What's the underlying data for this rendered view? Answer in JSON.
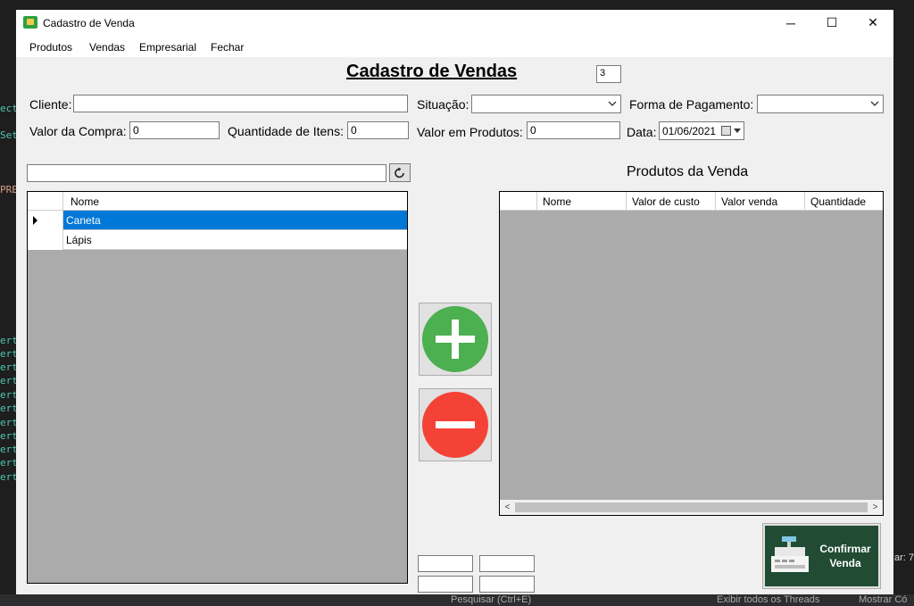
{
  "window": {
    "title": "Cadastro de Venda",
    "minimize": "─",
    "maximize": "☐",
    "close": "✕"
  },
  "menu": [
    "Produtos",
    "Vendas",
    "Empresarial",
    "Fechar"
  ],
  "form": {
    "heading": "Cadastro de Vendas",
    "sale_id": "3",
    "cliente_label": "Cliente:",
    "cliente_value": "",
    "situacao_label": "Situação:",
    "situacao_value": "",
    "pagamento_label": "Forma de Pagamento:",
    "pagamento_value": "",
    "valor_compra_label": "Valor da Compra:",
    "valor_compra_value": "0",
    "qtd_itens_label": "Quantidade de Itens:",
    "qtd_itens_value": "0",
    "valor_produtos_label": "Valor em Produtos:",
    "valor_produtos_value": "0",
    "data_label": "Data:",
    "data_value": "01/06/2021"
  },
  "search": {
    "value": ""
  },
  "products_grid": {
    "columns": [
      "Nome"
    ],
    "rows": [
      {
        "nome": "Caneta",
        "selected": true
      },
      {
        "nome": "Lápis",
        "selected": false
      }
    ]
  },
  "sale_grid": {
    "title": "Produtos da Venda",
    "columns": [
      "Nome",
      "Valor de custo",
      "Valor venda",
      "Quantidade"
    ],
    "rows": []
  },
  "buttons": {
    "add_icon": "plus-icon",
    "remove_icon": "minus-icon",
    "add_color": "#4caf50",
    "remove_color": "#f44336",
    "confirm_line1": "Confirmar",
    "confirm_line2": "Venda",
    "confirm_bg": "#214b33"
  },
  "background": {
    "left_fragments": [
      "ect",
      "Set",
      "PRE",
      "ert",
      "ert",
      "ert",
      "ert",
      "ert",
      "ert",
      "ert",
      "ert",
      "ert",
      "ert",
      "ert"
    ],
    "right_fragments": [
      "ar: 7"
    ],
    "bottom_search": "Pesquisar (Ctrl+E)",
    "bottom_threads": "Exibir todos os Threads",
    "bottom_show": "Mostrar Có"
  }
}
